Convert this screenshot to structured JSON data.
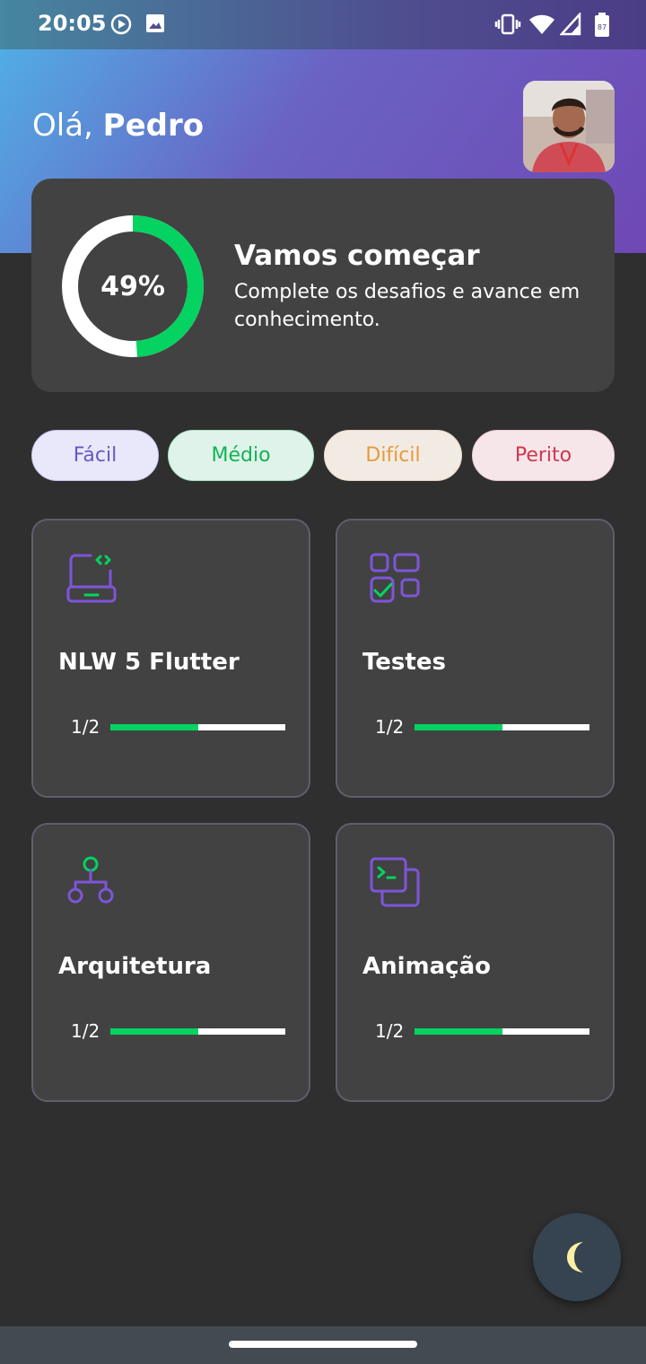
{
  "status_bar": {
    "time": "20:05",
    "icons": [
      "play-circle-icon",
      "image-icon",
      "vibrate-icon",
      "wifi-icon",
      "signal-icon",
      "battery-icon"
    ],
    "battery_text": "87"
  },
  "header": {
    "greeting_prefix": "Olá, ",
    "user_name": "Pedro"
  },
  "score_card": {
    "percent": 0.49,
    "percent_label": "49%",
    "title": "Vamos começar",
    "subtitle": "Complete os desafios e avance em conhecimento.",
    "colors": {
      "progress": "#04d361",
      "track": "#ffffff"
    }
  },
  "levels": [
    {
      "label": "Fácil",
      "bg": "#e8e8fa",
      "border": "#c8c4f0",
      "text": "#6558c4"
    },
    {
      "label": "Médio",
      "bg": "#e0f3ea",
      "border": "#a9e3c4",
      "text": "#10b452"
    },
    {
      "label": "Difícil",
      "bg": "#f2ebe4",
      "border": "#e9d7c6",
      "text": "#e69a3a"
    },
    {
      "label": "Perito",
      "bg": "#f6e6e9",
      "border": "#ecc9d0",
      "text": "#d0384d"
    }
  ],
  "quizzes": [
    {
      "icon": "laptop-code-icon",
      "title": "NLW 5 Flutter",
      "progress_label": "1/2",
      "progress": 0.5
    },
    {
      "icon": "checklist-grid-icon",
      "title": "Testes",
      "progress_label": "1/2",
      "progress": 0.5
    },
    {
      "icon": "hierarchy-icon",
      "title": "Arquitetura",
      "progress_label": "1/2",
      "progress": 0.5
    },
    {
      "icon": "terminal-icon",
      "title": "Animação",
      "progress_label": "1/2",
      "progress": 0.5
    }
  ],
  "fab": {
    "icon": "moon-icon"
  },
  "colors": {
    "background": "#2f2f2f",
    "card": "#424242",
    "accent": "#04d361",
    "icon_purple": "#7e55d9"
  }
}
